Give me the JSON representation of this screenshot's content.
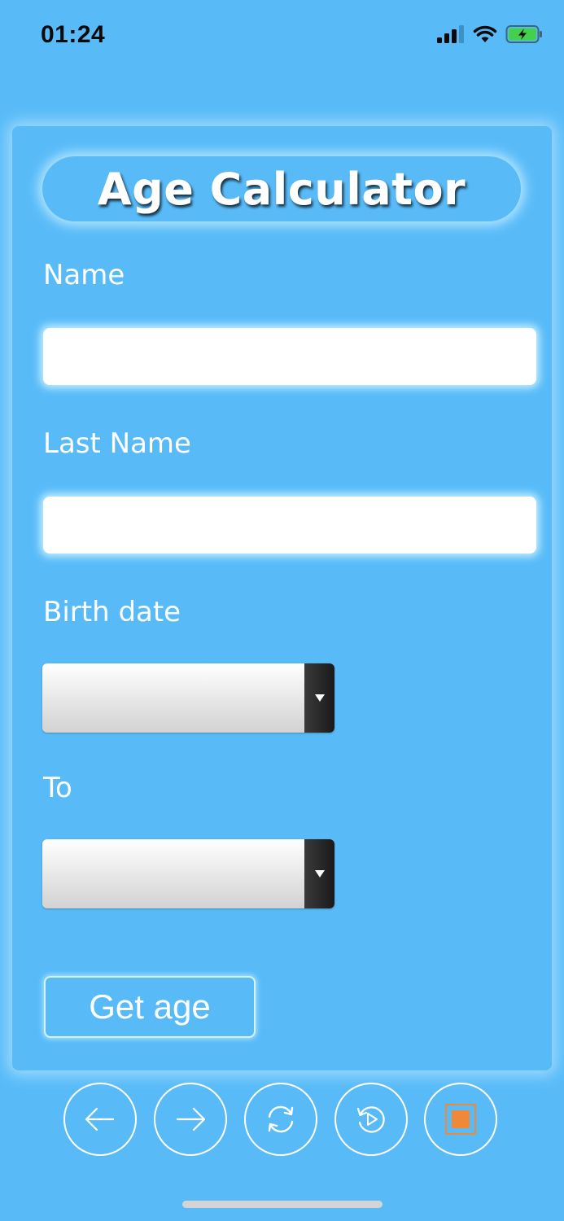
{
  "status_bar": {
    "time": "01:24"
  },
  "app": {
    "title": "Age Calculator"
  },
  "form": {
    "name_label": "Name",
    "name_value": "",
    "last_name_label": "Last Name",
    "last_name_value": "",
    "birth_date_label": "Birth date",
    "birth_date_value": "",
    "to_label": "To",
    "to_value": "",
    "submit_label": "Get age"
  },
  "toolbar": {
    "icons": [
      "arrow-left-icon",
      "arrow-right-icon",
      "refresh-icon",
      "replay-icon",
      "stop-icon"
    ]
  },
  "colors": {
    "background": "#58bbf8",
    "glow": "#c8f0ff",
    "stop_accent": "#f0883a"
  }
}
